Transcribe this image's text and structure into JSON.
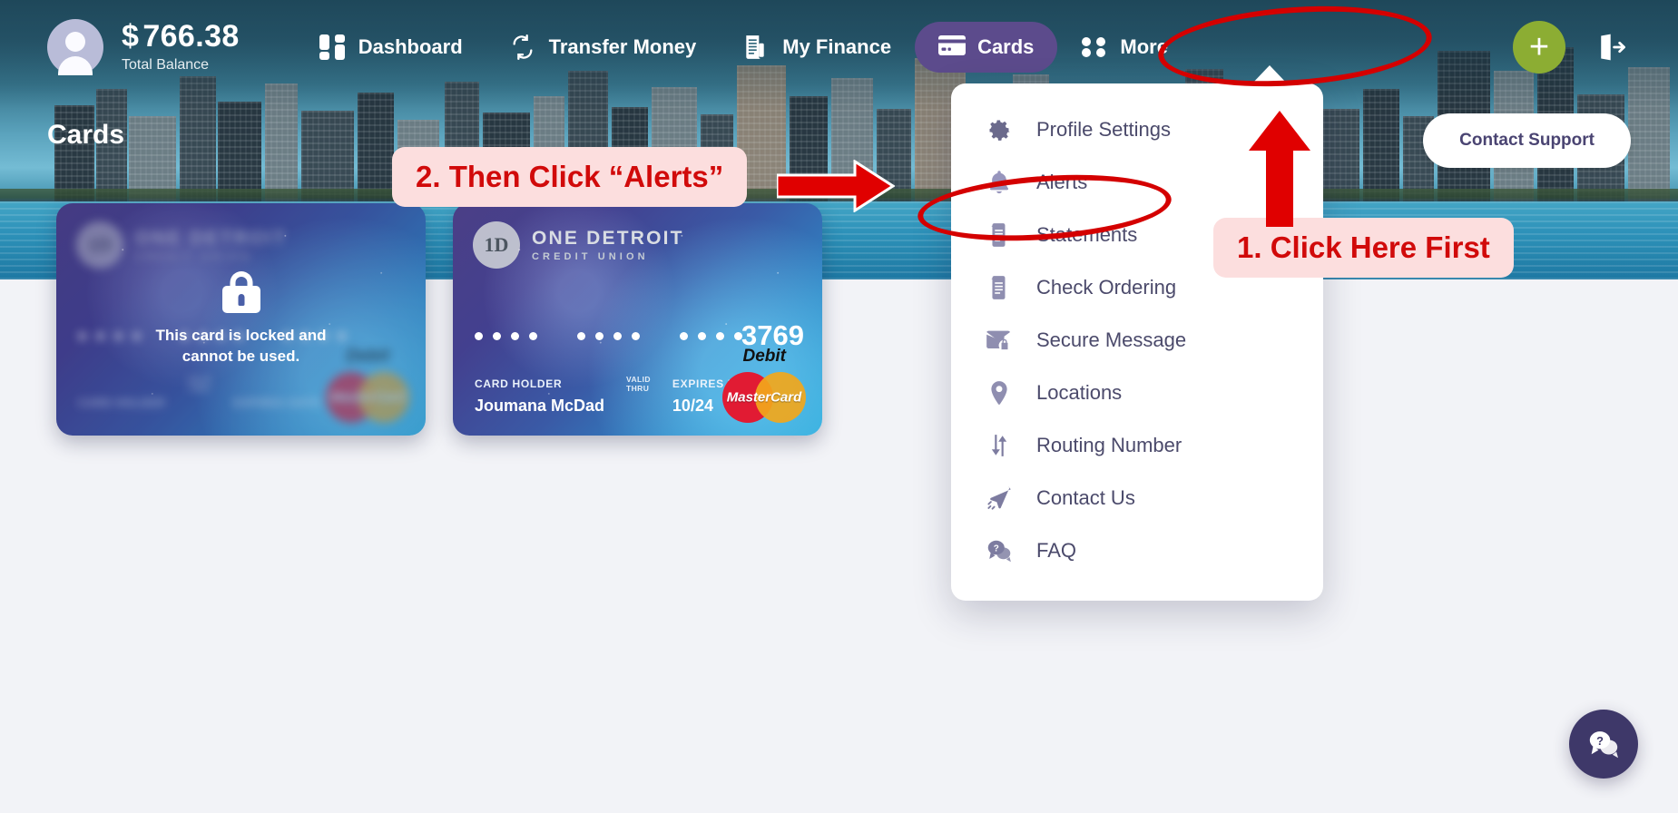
{
  "header": {
    "balance_currency": "$",
    "balance_amount": "766.38",
    "balance_label": "Total Balance",
    "avatar_icon": "user-avatar-icon",
    "nav": [
      {
        "label": "Dashboard",
        "icon": "dashboard-icon",
        "active": false
      },
      {
        "label": "Transfer Money",
        "icon": "transfer-money-icon",
        "active": false
      },
      {
        "label": "My Finance",
        "icon": "my-finance-icon",
        "active": false
      },
      {
        "label": "Cards",
        "icon": "credit-card-icon",
        "active": true
      },
      {
        "label": "More",
        "icon": "more-grid-icon",
        "active": false
      }
    ],
    "add_icon": "plus-icon",
    "logout_icon": "logout-icon",
    "accent_active": "#5c4b8c",
    "accent_add": "#8cad33"
  },
  "page": {
    "title": "Cards",
    "support_button": "Contact Support"
  },
  "cards": [
    {
      "state": "locked",
      "locked_message": "This card is locked and cannot be used.",
      "lock_icon": "lock-icon",
      "brand_badge": "1D",
      "brand_name": "ONE DETROIT",
      "brand_sub": "CREDIT UNION",
      "holder_label": "CARD HOLDER",
      "holder_name": "",
      "valid_thru": "VALID THRU",
      "expiry_label": "EXPIRES DATE",
      "expiry_value": "",
      "last4": "",
      "network": "MasterCard",
      "network_type": "Debit"
    },
    {
      "state": "active",
      "brand_badge": "1D",
      "brand_name": "ONE DETROIT",
      "brand_sub": "CREDIT UNION",
      "holder_label": "CARD HOLDER",
      "holder_name": "Joumana McDad",
      "valid_thru": "VALID THRU",
      "expiry_label": "EXPIRES DATE",
      "expiry_value": "10/24",
      "last4": "3769",
      "network": "MasterCard",
      "network_type": "Debit"
    }
  ],
  "dropdown": {
    "items": [
      {
        "label": "Profile Settings",
        "icon": "gear-icon"
      },
      {
        "label": "Alerts",
        "icon": "bell-icon"
      },
      {
        "label": "Statements",
        "icon": "document-icon"
      },
      {
        "label": "Check Ordering",
        "icon": "document-icon"
      },
      {
        "label": "Secure Message",
        "icon": "secure-mail-icon"
      },
      {
        "label": "Locations",
        "icon": "map-pin-icon"
      },
      {
        "label": "Routing Number",
        "icon": "routing-arrows-icon"
      },
      {
        "label": "Contact Us",
        "icon": "paper-plane-icon"
      },
      {
        "label": "FAQ",
        "icon": "faq-bubble-icon"
      }
    ]
  },
  "annotations": {
    "step1": "1. Click Here First",
    "step2": "2. Then Click “Alerts”",
    "highlight_color": "#d40000",
    "callout_bg": "#fcdede"
  },
  "chat": {
    "icon": "chat-help-icon",
    "color": "#3e3869"
  }
}
